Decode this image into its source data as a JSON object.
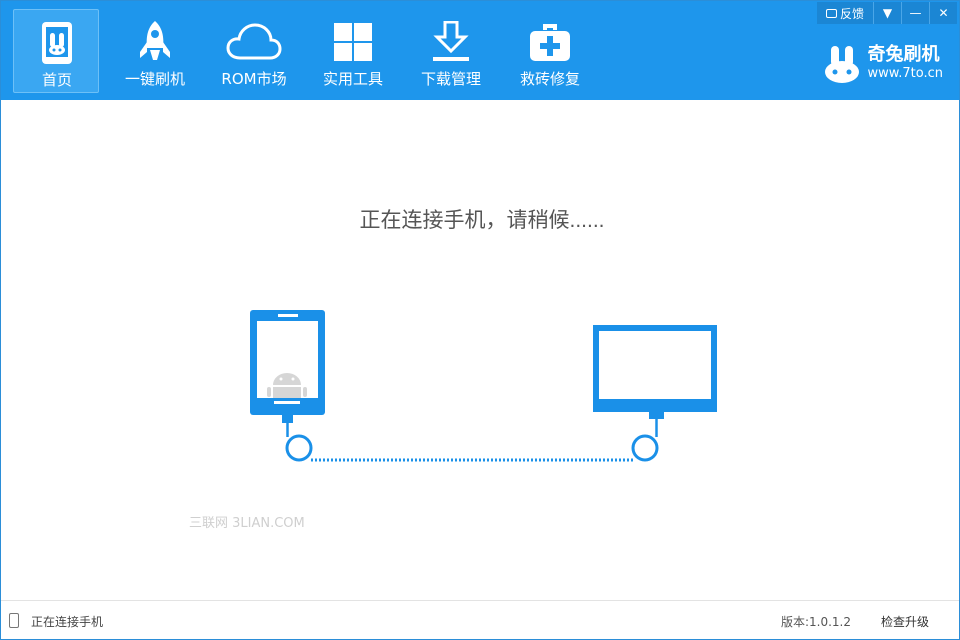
{
  "colors": {
    "accent": "#1e96ec",
    "illustration": "#1a90e8",
    "text": "#555555"
  },
  "nav": {
    "items": [
      {
        "label": "首页",
        "icon": "home-phone-icon",
        "active": true
      },
      {
        "label": "一键刷机",
        "icon": "rocket-icon",
        "active": false
      },
      {
        "label": "ROM市场",
        "icon": "cloud-icon",
        "active": false
      },
      {
        "label": "实用工具",
        "icon": "grid-icon",
        "active": false
      },
      {
        "label": "下载管理",
        "icon": "download-icon",
        "active": false
      },
      {
        "label": "救砖修复",
        "icon": "first-aid-icon",
        "active": false
      }
    ]
  },
  "window_controls": {
    "feedback_label": "反馈"
  },
  "brand": {
    "name": "奇兔刷机",
    "url": "www.7to.cn"
  },
  "main": {
    "status_message": "正在连接手机，请稍候......",
    "watermark": "三联网 3LIAN.COM"
  },
  "statusbar": {
    "connection_text": "正在连接手机",
    "version": "版本:1.0.1.2",
    "check_update_label": "检查升级"
  }
}
